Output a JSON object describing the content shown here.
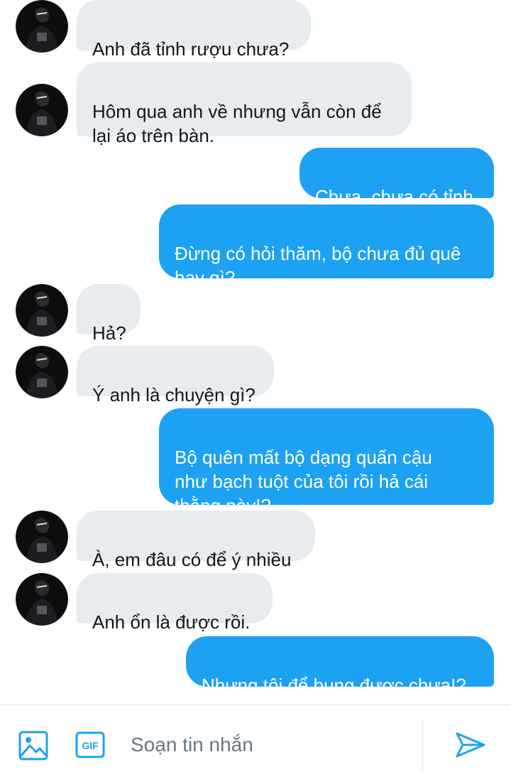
{
  "messages": [
    {
      "dir": "in",
      "text": "Anh đã tỉnh rượu chưa?"
    },
    {
      "dir": "in",
      "text": "Hôm qua anh về nhưng vẫn còn để\nlại áo trên bàn."
    },
    {
      "dir": "out",
      "text": "Chưa, chưa có tỉnh"
    },
    {
      "dir": "out",
      "text": "Đừng có hỏi thăm, bộ chưa đủ quê\nhay gì?"
    },
    {
      "dir": "in",
      "text": "Hả?"
    },
    {
      "dir": "in",
      "text": "Ý anh là chuyện gì?"
    },
    {
      "dir": "out",
      "text": "Bộ quên mất bộ dạng quấn cậu\nnhư bạch tuột của tôi rồi hả cái\nthằng này!?"
    },
    {
      "dir": "in",
      "text": "À, em đâu có để ý nhiều"
    },
    {
      "dir": "in",
      "text": "Anh ổn là được rồi."
    },
    {
      "dir": "out",
      "text": "Nhưng tôi để bụng được chưa!?"
    }
  ],
  "composer": {
    "placeholder": "Soạn tin nhắn",
    "gif_label": "GIF",
    "image_icon": "image-icon",
    "gif_icon": "gif-icon",
    "send_icon": "send-icon"
  },
  "colors": {
    "incoming_bubble": "#e6ecf0",
    "outgoing_bubble": "#1da1f2",
    "accent": "#1da1f2"
  }
}
